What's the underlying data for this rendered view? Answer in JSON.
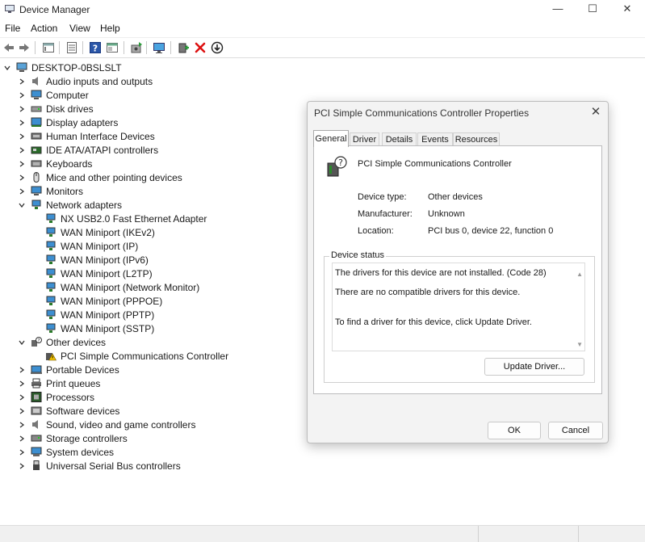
{
  "window": {
    "title": "Device Manager",
    "minimize": "—",
    "maximize": "☐",
    "close": "✕"
  },
  "menu": [
    "File",
    "Action",
    "View",
    "Help"
  ],
  "toolbar_icons": [
    "back-icon",
    "forward-icon",
    "properties-icon",
    "show-hidden-icon",
    "help-icon",
    "view-icon",
    "update-driver-icon",
    "monitor-icon",
    "enable-device-icon",
    "uninstall-icon",
    "download-icon"
  ],
  "tree": {
    "root": "DESKTOP-0BSLSLT",
    "categories": [
      {
        "label": "Audio inputs and outputs",
        "icon": "speaker-icon"
      },
      {
        "label": "Computer",
        "icon": "computer-icon"
      },
      {
        "label": "Disk drives",
        "icon": "disk-icon"
      },
      {
        "label": "Display adapters",
        "icon": "display-adapter-icon"
      },
      {
        "label": "Human Interface Devices",
        "icon": "hid-icon"
      },
      {
        "label": "IDE ATA/ATAPI controllers",
        "icon": "ide-icon"
      },
      {
        "label": "Keyboards",
        "icon": "keyboard-icon"
      },
      {
        "label": "Mice and other pointing devices",
        "icon": "mouse-icon"
      },
      {
        "label": "Monitors",
        "icon": "monitor-icon"
      },
      {
        "label": "Network adapters",
        "icon": "network-icon",
        "expanded": true
      }
    ],
    "network_children": [
      "NX USB2.0 Fast Ethernet Adapter",
      "WAN Miniport (IKEv2)",
      "WAN Miniport (IP)",
      "WAN Miniport (IPv6)",
      "WAN Miniport (L2TP)",
      "WAN Miniport (Network Monitor)",
      "WAN Miniport (PPPOE)",
      "WAN Miniport (PPTP)",
      "WAN Miniport (SSTP)"
    ],
    "other_devices": {
      "label": "Other devices",
      "child": "PCI Simple Communications Controller"
    },
    "rest": [
      {
        "label": "Portable Devices",
        "icon": "portable-icon"
      },
      {
        "label": "Print queues",
        "icon": "printer-icon"
      },
      {
        "label": "Processors",
        "icon": "processor-icon"
      },
      {
        "label": "Software devices",
        "icon": "software-icon"
      },
      {
        "label": "Sound, video and game controllers",
        "icon": "sound-icon"
      },
      {
        "label": "Storage controllers",
        "icon": "storage-icon"
      },
      {
        "label": "System devices",
        "icon": "system-icon"
      },
      {
        "label": "Universal Serial Bus controllers",
        "icon": "usb-icon"
      }
    ]
  },
  "dialog": {
    "title": "PCI Simple Communications Controller Properties",
    "tabs": [
      "General",
      "Driver",
      "Details",
      "Events",
      "Resources"
    ],
    "active_tab": "General",
    "device_name": "PCI Simple Communications Controller",
    "properties": [
      {
        "label": "Device type:",
        "value": "Other devices"
      },
      {
        "label": "Manufacturer:",
        "value": "Unknown"
      },
      {
        "label": "Location:",
        "value": "PCI bus 0, device 22, function 0"
      }
    ],
    "status_legend": "Device status",
    "status_lines": [
      "The drivers for this device are not installed. (Code 28)",
      "There are no compatible drivers for this device.",
      "To find a driver for this device, click Update Driver."
    ],
    "update_button": "Update Driver...",
    "ok_button": "OK",
    "cancel_button": "Cancel"
  }
}
